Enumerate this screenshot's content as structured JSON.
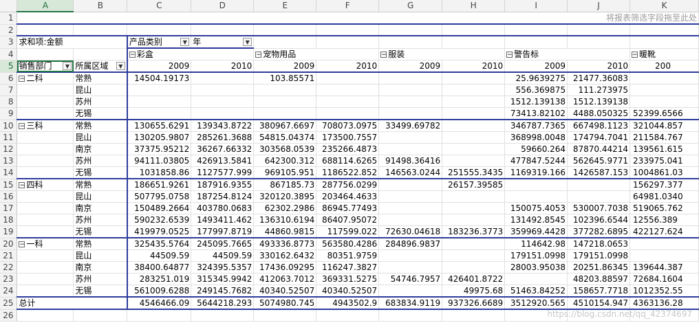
{
  "columns": [
    "A",
    "B",
    "C",
    "D",
    "E",
    "F",
    "G",
    "H",
    "I",
    "J",
    "K"
  ],
  "drop_hint": "将报表筛选字段拖至此处",
  "value_label": "求和项:金额",
  "col_field_1": "产品类别",
  "col_field_2": "年",
  "categories": [
    "彩盒",
    "宠物用品",
    "服装",
    "警告标",
    "暖靴"
  ],
  "years": [
    "2009",
    "2010",
    "2009",
    "2010",
    "2009",
    "2010",
    "2009",
    "2010",
    "200"
  ],
  "row_field_1": "销售部门",
  "row_field_2": "所属区域",
  "rows": [
    {
      "n": "6",
      "a": "二科",
      "b": "常熟",
      "v": [
        "14504.19173",
        "",
        "103.85571",
        "",
        "",
        "",
        "25.9639275",
        "21477.36083",
        ""
      ]
    },
    {
      "n": "7",
      "a": "",
      "b": "昆山",
      "v": [
        "",
        "",
        "",
        "",
        "",
        "",
        "556.369875",
        "111.273975",
        ""
      ]
    },
    {
      "n": "8",
      "a": "",
      "b": "苏州",
      "v": [
        "",
        "",
        "",
        "",
        "",
        "",
        "1512.139138",
        "1512.139138",
        ""
      ]
    },
    {
      "n": "9",
      "a": "",
      "b": "无锡",
      "v": [
        "",
        "",
        "",
        "",
        "",
        "",
        "73413.82102",
        "4488.050325",
        "52399.6566"
      ]
    },
    {
      "n": "10",
      "a": "三科",
      "b": "常熟",
      "v": [
        "130655.6291",
        "139343.8722",
        "380967.6697",
        "708073.0975",
        "33499.69782",
        "",
        "346787.7365",
        "667498.1123",
        "321044.857"
      ]
    },
    {
      "n": "11",
      "a": "",
      "b": "昆山",
      "v": [
        "130205.9807",
        "285261.3688",
        "54815.04374",
        "173500.7557",
        "",
        "",
        "368998.0048",
        "174794.7041",
        "211584.767"
      ]
    },
    {
      "n": "12",
      "a": "",
      "b": "南京",
      "v": [
        "37375.95212",
        "36267.66332",
        "303568.0539",
        "235266.4873",
        "",
        "",
        "59660.264",
        "87870.44214",
        "139561.615"
      ]
    },
    {
      "n": "13",
      "a": "",
      "b": "苏州",
      "v": [
        "94111.03805",
        "426913.5841",
        "642300.312",
        "688114.6265",
        "91498.36416",
        "",
        "477847.5244",
        "562645.9771",
        "233975.041"
      ]
    },
    {
      "n": "14",
      "a": "",
      "b": "无锡",
      "v": [
        "1031858.86",
        "1127577.999",
        "969105.951",
        "1186522.852",
        "146563.0244",
        "251555.3435",
        "1169319.166",
        "1426587.153",
        "1004861.03"
      ]
    },
    {
      "n": "15",
      "a": "四科",
      "b": "常熟",
      "v": [
        "186651.9261",
        "187916.9355",
        "867185.73",
        "287756.0299",
        "",
        "26157.39585",
        "",
        "",
        "156297.377"
      ]
    },
    {
      "n": "16",
      "a": "",
      "b": "昆山",
      "v": [
        "507795.0758",
        "187254.8124",
        "320120.3895",
        "203464.4633",
        "",
        "",
        "",
        "",
        "64981.0340"
      ]
    },
    {
      "n": "17",
      "a": "",
      "b": "南京",
      "v": [
        "150489.2664",
        "403780.0683",
        "62302.2986",
        "86945.77493",
        "",
        "",
        "150075.4053",
        "530007.7038",
        "519065.762"
      ]
    },
    {
      "n": "18",
      "a": "",
      "b": "苏州",
      "v": [
        "590232.6539",
        "1493411.462",
        "136310.6194",
        "86407.95072",
        "",
        "",
        "131492.8545",
        "102396.6544",
        "12556.389"
      ]
    },
    {
      "n": "19",
      "a": "",
      "b": "无锡",
      "v": [
        "419979.0525",
        "177997.8719",
        "44860.9815",
        "117599.022",
        "72630.04618",
        "183236.3773",
        "359969.4428",
        "377282.6895",
        "422127.624"
      ]
    },
    {
      "n": "20",
      "a": "一科",
      "b": "常熟",
      "v": [
        "325435.5764",
        "245095.7665",
        "493336.8773",
        "563580.4286",
        "284896.9837",
        "",
        "114642.98",
        "147218.0653",
        ""
      ]
    },
    {
      "n": "21",
      "a": "",
      "b": "昆山",
      "v": [
        "44509.59",
        "44509.59",
        "330162.6432",
        "80351.9759",
        "",
        "",
        "179151.0998",
        "179151.0998",
        ""
      ]
    },
    {
      "n": "22",
      "a": "",
      "b": "南京",
      "v": [
        "38400.64877",
        "324395.5357",
        "17436.09295",
        "116247.3827",
        "",
        "",
        "28003.95038",
        "20251.86345",
        "139644.387"
      ]
    },
    {
      "n": "23",
      "a": "",
      "b": "苏州",
      "v": [
        "283251.019",
        "315345.9942",
        "412063.7012",
        "369331.5275",
        "54746.7957",
        "426401.8722",
        "",
        "48203.88597",
        "72684.1604"
      ]
    },
    {
      "n": "24",
      "a": "",
      "b": "无锡",
      "v": [
        "561009.6288",
        "249145.7682",
        "40340.52507",
        "40340.52507",
        "",
        "49975.68",
        "51463.84252",
        "158657.7718",
        "1012352.55"
      ]
    }
  ],
  "total": {
    "n": "25",
    "label": "总计",
    "v": [
      "4546466.09",
      "5644218.293",
      "5074980.745",
      "4943502.9",
      "683834.9119",
      "937326.6689",
      "3512920.565",
      "4510154.947",
      "4363136.28"
    ]
  },
  "watermark": "https://blog.csdn.net/qq_42374697",
  "colors": {
    "pivot_border": "#2d3a9a",
    "header_bg": "#f3f3f3",
    "selected_header": "#217346"
  }
}
